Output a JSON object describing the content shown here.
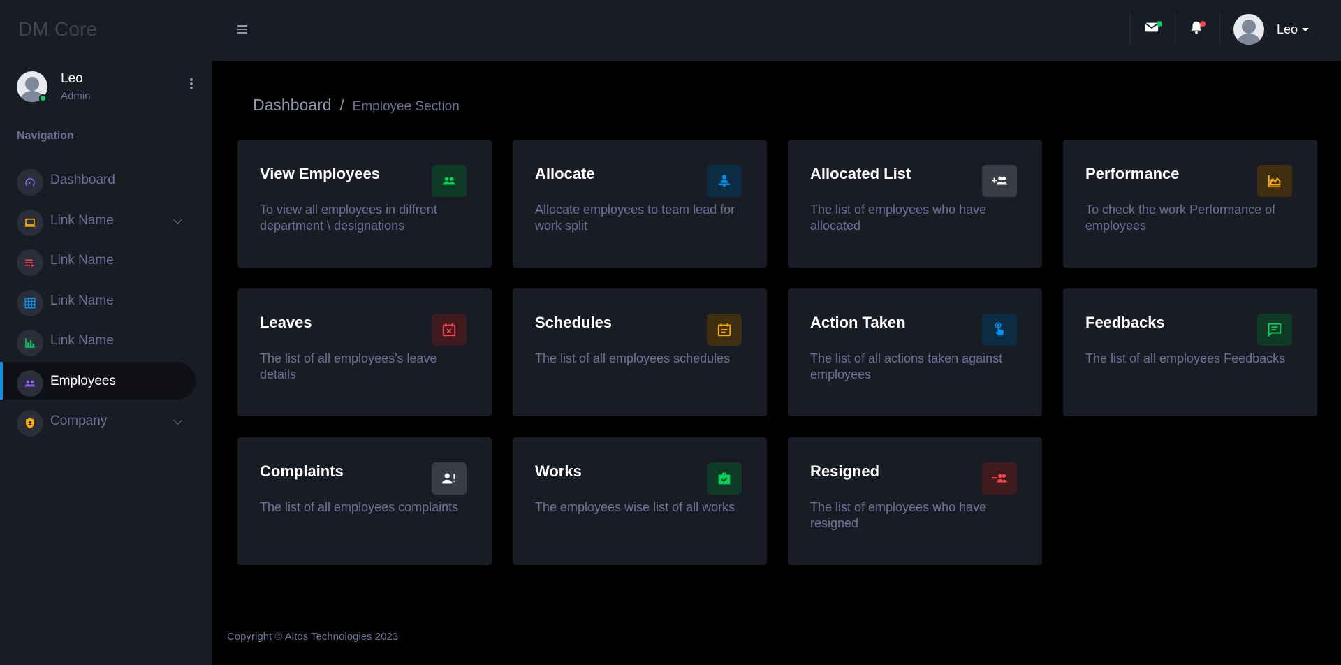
{
  "app": {
    "brand": "DM Core"
  },
  "sidebar": {
    "profile": {
      "name": "Leo",
      "role": "Admin"
    },
    "nav_heading": "Navigation",
    "items": [
      {
        "label": "Dashboard",
        "icon": "speedometer-icon",
        "icon_color": "#8f5fe8",
        "active": false,
        "has_submenu": false
      },
      {
        "label": "Link Name",
        "icon": "laptop-icon",
        "icon_color": "#ffab00",
        "active": false,
        "has_submenu": true
      },
      {
        "label": "Link Name",
        "icon": "playlist-icon",
        "icon_color": "#fc424a",
        "active": false,
        "has_submenu": false
      },
      {
        "label": "Link Name",
        "icon": "table-icon",
        "icon_color": "#0090e7",
        "active": false,
        "has_submenu": false
      },
      {
        "label": "Link Name",
        "icon": "chart-bar-icon",
        "icon_color": "#00d25b",
        "active": false,
        "has_submenu": false
      },
      {
        "label": "Employees",
        "icon": "users-icon",
        "icon_color": "#8f5fe8",
        "active": true,
        "has_submenu": false
      },
      {
        "label": "Company",
        "icon": "shield-icon",
        "icon_color": "#ffab00",
        "active": false,
        "has_submenu": true
      }
    ]
  },
  "topbar": {
    "user_name": "Leo",
    "mail_dot_color": "#00d25b",
    "bell_dot_color": "#fc424a"
  },
  "breadcrumb": {
    "main": "Dashboard",
    "separator": "/",
    "current": "Employee Section"
  },
  "cards": [
    {
      "title": "View Employees",
      "description": "To view all employees in diffrent department \\ designations",
      "icon": "users-icon",
      "icon_color": "#00d25b",
      "icon_bg": "#0f3a25"
    },
    {
      "title": "Allocate",
      "description": "Allocate employees to team lead for work split",
      "icon": "user-desk-icon",
      "icon_color": "#0090e7",
      "icon_bg": "#0c2c44"
    },
    {
      "title": "Allocated List",
      "description": "The list of employees who have allocated",
      "icon": "user-add-icon",
      "icon_color": "#ffffff",
      "icon_bg": "#3a3d47"
    },
    {
      "title": "Performance",
      "description": "To check the work Performance of employees",
      "icon": "chart-area-icon",
      "icon_color": "#ffab00",
      "icon_bg": "#3d2f10"
    },
    {
      "title": "Leaves",
      "description": "The list of all employees's leave details",
      "icon": "calendar-remove-icon",
      "icon_color": "#fc424a",
      "icon_bg": "#3f1a1f"
    },
    {
      "title": "Schedules",
      "description": "The list of all employees schedules",
      "icon": "calendar-text-icon",
      "icon_color": "#ffab00",
      "icon_bg": "#3d2f10"
    },
    {
      "title": "Action Taken",
      "description": "The list of all actions taken against employees",
      "icon": "hand-pointer-icon",
      "icon_color": "#0090e7",
      "icon_bg": "#0c2c44"
    },
    {
      "title": "Feedbacks",
      "description": "The list of all employees Feedbacks",
      "icon": "message-text-icon",
      "icon_color": "#00d25b",
      "icon_bg": "#0f3a25"
    },
    {
      "title": "Complaints",
      "description": "The list of all employees complaints",
      "icon": "user-alert-icon",
      "icon_color": "#ffffff",
      "icon_bg": "#3a3d47"
    },
    {
      "title": "Works",
      "description": "The employees wise list of all works",
      "icon": "briefcase-check-icon",
      "icon_color": "#00d25b",
      "icon_bg": "#0f3a25"
    },
    {
      "title": "Resigned",
      "description": "The list of employees who have resigned",
      "icon": "user-remove-icon",
      "icon_color": "#fc424a",
      "icon_bg": "#3f1a1f"
    }
  ],
  "footer": {
    "text": "Copyright © Altos Technologies 2023"
  }
}
